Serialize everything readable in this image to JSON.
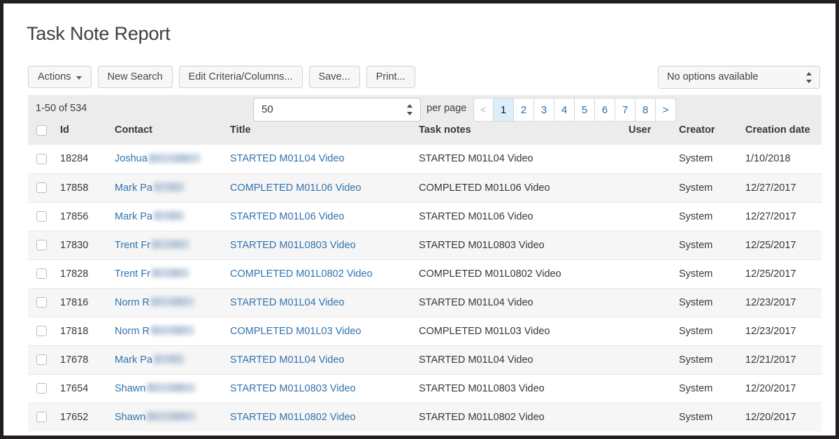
{
  "page_title": "Task Note Report",
  "toolbar": {
    "actions_label": "Actions",
    "new_search_label": "New Search",
    "edit_criteria_label": "Edit Criteria/Columns...",
    "save_label": "Save...",
    "print_label": "Print...",
    "options_select_value": "No options available"
  },
  "pagination": {
    "range_label": "1-50 of 534",
    "per_page_value": "50",
    "per_page_label": "per page",
    "prev_label": "<",
    "next_label": ">",
    "pages": [
      "1",
      "2",
      "3",
      "4",
      "5",
      "6",
      "7",
      "8"
    ],
    "active_page": "1"
  },
  "table": {
    "columns": [
      "",
      "Id",
      "Contact",
      "Title",
      "Task notes",
      "User",
      "Creator",
      "Creation date"
    ],
    "rows": [
      {
        "id": "18284",
        "contact": "Joshua",
        "contact_redacted_width": 74,
        "title": "STARTED M01L04 Video",
        "notes": "STARTED M01L04 Video",
        "user": "",
        "creator": "System",
        "date": "1/10/2018"
      },
      {
        "id": "17858",
        "contact": "Mark Pa",
        "contact_redacted_width": 44,
        "title": "COMPLETED M01L06 Video",
        "notes": "COMPLETED M01L06 Video",
        "user": "",
        "creator": "System",
        "date": "12/27/2017"
      },
      {
        "id": "17856",
        "contact": "Mark Pa",
        "contact_redacted_width": 44,
        "title": "STARTED M01L06 Video",
        "notes": "STARTED M01L06 Video",
        "user": "",
        "creator": "System",
        "date": "12/27/2017"
      },
      {
        "id": "17830",
        "contact": "Trent Fr",
        "contact_redacted_width": 54,
        "title": "STARTED M01L0803 Video",
        "notes": "STARTED M01L0803 Video",
        "user": "",
        "creator": "System",
        "date": "12/25/2017"
      },
      {
        "id": "17828",
        "contact": "Trent Fr",
        "contact_redacted_width": 54,
        "title": "COMPLETED M01L0802 Video",
        "notes": "COMPLETED M01L0802 Video",
        "user": "",
        "creator": "System",
        "date": "12/25/2017"
      },
      {
        "id": "17816",
        "contact": "Norm R",
        "contact_redacted_width": 62,
        "title": "STARTED M01L04 Video",
        "notes": "STARTED M01L04 Video",
        "user": "",
        "creator": "System",
        "date": "12/23/2017"
      },
      {
        "id": "17818",
        "contact": "Norm R",
        "contact_redacted_width": 62,
        "title": "COMPLETED M01L03 Video",
        "notes": "COMPLETED M01L03 Video",
        "user": "",
        "creator": "System",
        "date": "12/23/2017"
      },
      {
        "id": "17678",
        "contact": "Mark Pa",
        "contact_redacted_width": 44,
        "title": "STARTED M01L04 Video",
        "notes": "STARTED M01L04 Video",
        "user": "",
        "creator": "System",
        "date": "12/21/2017"
      },
      {
        "id": "17654",
        "contact": "Shawn",
        "contact_redacted_width": 70,
        "title": "STARTED M01L0803 Video",
        "notes": "STARTED M01L0803 Video",
        "user": "",
        "creator": "System",
        "date": "12/20/2017"
      },
      {
        "id": "17652",
        "contact": "Shawn",
        "contact_redacted_width": 70,
        "title": "STARTED M01L0802 Video",
        "notes": "STARTED M01L0802 Video",
        "user": "",
        "creator": "System",
        "date": "12/20/2017"
      }
    ]
  },
  "colors": {
    "link": "#3273ad",
    "header_bg": "#ececec",
    "active_page_bg": "#ddeefa",
    "stripe_bg": "#f6f6f6"
  }
}
